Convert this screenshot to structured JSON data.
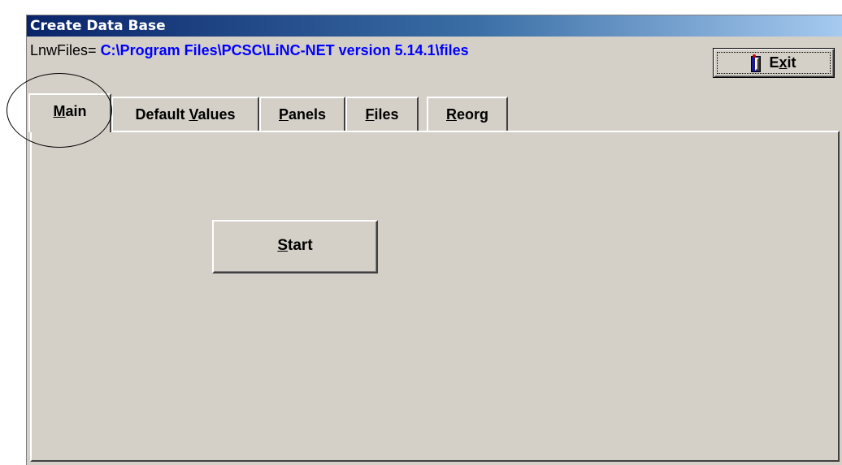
{
  "window": {
    "title": "Create Data Base"
  },
  "path": {
    "label": "LnwFiles=",
    "value": "C:\\Program Files\\PCSC\\LiNC-NET version 5.14.1\\files"
  },
  "exit_button": {
    "label_prefix": "E",
    "label_mnemonic": "x",
    "label_suffix": "it",
    "icon": "exit-door-icon"
  },
  "tabs": [
    {
      "pre": "",
      "mn": "M",
      "post": "ain",
      "active": true
    },
    {
      "pre": "Default ",
      "mn": "V",
      "post": "alues",
      "active": false
    },
    {
      "pre": "",
      "mn": "P",
      "post": "anels",
      "active": false
    },
    {
      "pre": "",
      "mn": "F",
      "post": "iles",
      "active": false
    },
    {
      "pre": "",
      "mn": "R",
      "post": "eorg",
      "active": false
    }
  ],
  "main": {
    "start_mnemonic": "S",
    "start_rest": "tart"
  },
  "colors": {
    "face": "#d4d0c8",
    "title_gradient_start": "#0a246a",
    "title_gradient_end": "#a6caf0",
    "path_value": "#0000ff"
  }
}
